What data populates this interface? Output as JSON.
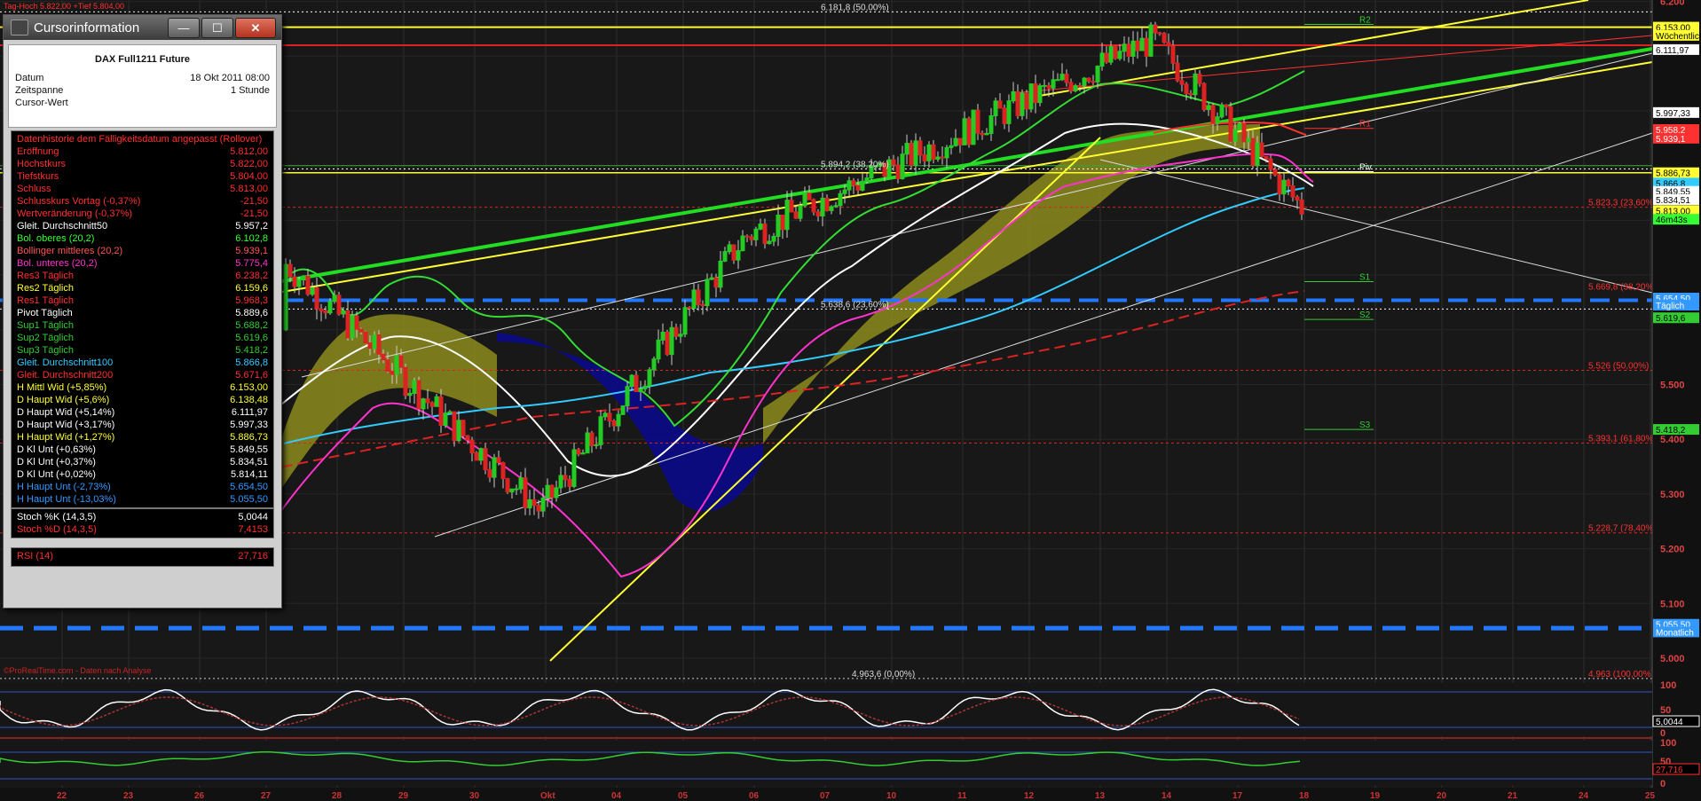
{
  "window": {
    "title": "Cursorinformation",
    "instrument": "DAX Full1211 Future",
    "info": [
      {
        "label": "Datum",
        "value": "18 Okt 2011 08:00"
      },
      {
        "label": "Zeitspanne",
        "value": "1 Stunde"
      },
      {
        "label": "Cursor-Wert",
        "value": ""
      }
    ],
    "buttons": {
      "minimize": "—",
      "maximize": "☐",
      "close": "✕"
    }
  },
  "indicators": [
    {
      "label": "Datenhistorie dem Fälligkeitsdatum angepasst (Rollover)",
      "value": "",
      "color": "#ff3030"
    },
    {
      "label": "Eröffnung",
      "value": "5.812,00",
      "color": "#ff3030"
    },
    {
      "label": "Höchstkurs",
      "value": "5.822,00",
      "color": "#ff3030"
    },
    {
      "label": "Tiefstkurs",
      "value": "5.804,00",
      "color": "#ff3030"
    },
    {
      "label": "Schluss",
      "value": "5.813,00",
      "color": "#ff3030"
    },
    {
      "label": "Schlusskurs Vortag (-0,37%)",
      "value": "-21,50",
      "color": "#ff3030"
    },
    {
      "label": "Wertveränderung (-0,37%)",
      "value": "-21,50",
      "color": "#ff3030"
    },
    {
      "label": "Gleit. Durchschnitt50",
      "value": "5.957,2",
      "color": "#ffffff"
    },
    {
      "label": "Bol. oberes (20,2)",
      "value": "6.102,8",
      "color": "#33ff33"
    },
    {
      "label": "Bollinger mittleres (20,2)",
      "value": "5.939,1",
      "color": "#ff5555"
    },
    {
      "label": "Bol. unteres (20,2)",
      "value": "5.775,4",
      "color": "#ff33cc"
    },
    {
      "label": "Res3 Täglich",
      "value": "6.238,2",
      "color": "#ff3030"
    },
    {
      "label": "Res2 Täglich",
      "value": "6.159,6",
      "color": "#ffff33"
    },
    {
      "label": "Res1 Täglich",
      "value": "5.968,3",
      "color": "#ff3030"
    },
    {
      "label": "Pivot Täglich",
      "value": "5.889,6",
      "color": "#ffffff"
    },
    {
      "label": "Sup1 Täglich",
      "value": "5.688,2",
      "color": "#33cc33"
    },
    {
      "label": "Sup2 Täglich",
      "value": "5.619,6",
      "color": "#33cc33"
    },
    {
      "label": "Sup3 Täglich",
      "value": "5.418,2",
      "color": "#33cc33"
    },
    {
      "label": "Gleit. Durchschnitt100",
      "value": "5.866,8",
      "color": "#33ccff"
    },
    {
      "label": "Gleit. Durchschnitt200",
      "value": "5.671,6",
      "color": "#ff3030"
    },
    {
      "label": "H Mittl Wid (+5,85%)",
      "value": "6.153,00",
      "color": "#ffff33"
    },
    {
      "label": "D Haupt Wid (+5,6%)",
      "value": "6.138,48",
      "color": "#ffff33"
    },
    {
      "label": "D Haupt Wid (+5,14%)",
      "value": "6.111,97",
      "color": "#ffffff"
    },
    {
      "label": "D Haupt Wid (+3,17%)",
      "value": "5.997,33",
      "color": "#ffffff"
    },
    {
      "label": "H Haupt Wid (+1,27%)",
      "value": "5.886,73",
      "color": "#ffff33"
    },
    {
      "label": "D Kl Unt (+0,63%)",
      "value": "5.849,55",
      "color": "#ffffff"
    },
    {
      "label": "D Kl Unt (+0,37%)",
      "value": "5.834,51",
      "color": "#ffffff"
    },
    {
      "label": "D Kl Unt (+0,02%)",
      "value": "5.814,11",
      "color": "#ffffff"
    },
    {
      "label": "H Haupt Unt (-2,73%)",
      "value": "5.654,50",
      "color": "#3399ff"
    },
    {
      "label": "H Haupt Unt (-13,03%)",
      "value": "5.055,50",
      "color": "#3399ff"
    }
  ],
  "stoch": [
    {
      "label": "Stoch %K (14,3,5)",
      "value": "5,0044",
      "color": "#ffffff"
    },
    {
      "label": "Stoch %D (14,3,5)",
      "value": "7,4153",
      "color": "#ff3030"
    }
  ],
  "rsi": [
    {
      "label": "RSI (14)",
      "value": "27,716",
      "color": "#ff3030"
    }
  ],
  "price_axis": [
    "6.200",
    "5.500",
    "5.400",
    "5.300",
    "5.200",
    "5.100",
    "5.000"
  ],
  "axis_tags": [
    {
      "text": "6.153,00",
      "color": "#ffff33",
      "fg": "#000",
      "price": 6153
    },
    {
      "text": "Wöchentlich",
      "color": "#ffff33",
      "fg": "#000",
      "price": 6138
    },
    {
      "text": "6.111,97",
      "color": "#ffffff",
      "fg": "#000",
      "price": 6112
    },
    {
      "text": "5.997,33",
      "color": "#ffffff",
      "fg": "#000",
      "price": 5997
    },
    {
      "text": "5.958,2",
      "color": "#ff3030",
      "fg": "#fff",
      "price": 5966
    },
    {
      "text": "5.939,1",
      "color": "#ff3030",
      "fg": "#fff",
      "price": 5950
    },
    {
      "text": "5.886,73",
      "color": "#ffff33",
      "fg": "#000",
      "price": 5887
    },
    {
      "text": "5.866,8",
      "color": "#33ccff",
      "fg": "#000",
      "price": 5868
    },
    {
      "text": "5.849,55",
      "color": "#ffffff",
      "fg": "#000",
      "price": 5853
    },
    {
      "text": "5.834,51",
      "color": "#ffffff",
      "fg": "#000",
      "price": 5838
    },
    {
      "text": "5.813,00",
      "color": "#ffff33",
      "fg": "#000",
      "price": 5818
    },
    {
      "text": "46m43s",
      "color": "#33ff33",
      "fg": "#000",
      "price": 5802
    },
    {
      "text": "5.654,50",
      "color": "#3399ff",
      "fg": "#fff",
      "price": 5658
    },
    {
      "text": "Täglich",
      "color": "#3399ff",
      "fg": "#fff",
      "price": 5645
    },
    {
      "text": "5.619,6",
      "color": "#33cc33",
      "fg": "#000",
      "price": 5622
    },
    {
      "text": "5.418,2",
      "color": "#33cc33",
      "fg": "#000",
      "price": 5418
    },
    {
      "text": "5.055,50",
      "color": "#3399ff",
      "fg": "#fff",
      "price": 5062
    },
    {
      "text": "Monatlich",
      "color": "#3399ff",
      "fg": "#fff",
      "price": 5048
    }
  ],
  "fib_labels": [
    {
      "text": "6.181,8 (50,00%)",
      "price": 6181
    },
    {
      "text": "5.894,2 (38,20%)",
      "price": 5894
    },
    {
      "text": "5.638,6 (23,60%)",
      "price": 5638
    },
    {
      "text": "4.963,6 (0,00%)",
      "price": 4963
    }
  ],
  "fib_right_labels": [
    {
      "text": "5.823,3 (23,60%)",
      "price": 5824
    },
    {
      "text": "5.669,8 (38,20%)",
      "price": 5670
    },
    {
      "text": "5.526 (50,00%)",
      "price": 5526
    },
    {
      "text": "5.393,1 (61,80%)",
      "price": 5393
    },
    {
      "text": "5.228,7 (78,40%)",
      "price": 5229
    },
    {
      "text": "4.963 (100,00%)",
      "price": 4963
    }
  ],
  "pivot_labels": [
    {
      "text": "R2",
      "price": 6158,
      "color": "#33cc33"
    },
    {
      "text": "R1",
      "price": 5968,
      "color": "#ff3030"
    },
    {
      "text": "Piv",
      "price": 5889,
      "color": "#ffffff"
    },
    {
      "text": "S1",
      "price": 5688,
      "color": "#33cc33"
    },
    {
      "text": "S2",
      "price": 5619,
      "color": "#33cc33"
    },
    {
      "text": "S3",
      "price": 5418,
      "color": "#33cc33"
    }
  ],
  "osc_axis": [
    "100",
    "50",
    "0"
  ],
  "osc_tag": "5,0044",
  "rsi_tag": "27,716",
  "top_status": "Tag-Hoch 5.822,00 +Tief 5.804,00",
  "watermark": "©ProRealTime.com - Daten nach Analyse",
  "time_axis": [
    "22",
    "23",
    "26",
    "27",
    "28",
    "29",
    "30",
    "Okt",
    "04",
    "05",
    "06",
    "07",
    "10",
    "11",
    "12",
    "13",
    "14",
    "17",
    "18",
    "19",
    "20",
    "21",
    "24",
    "25"
  ]
}
